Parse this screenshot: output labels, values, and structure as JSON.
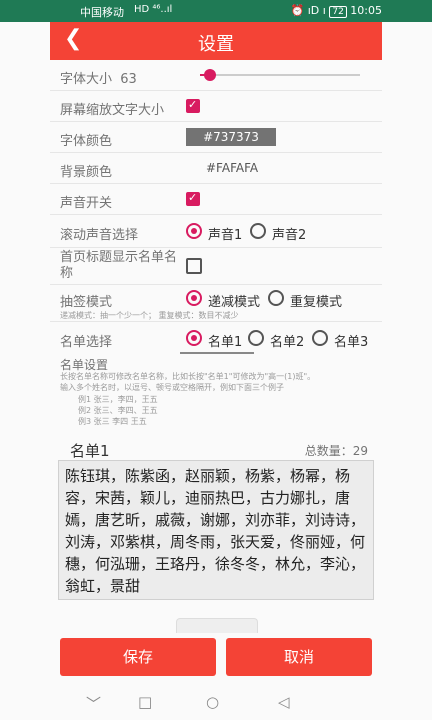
{
  "statusbar": {
    "carrier": "中国移动",
    "signal": "HD ⁴⁶..ıl",
    "icons": "⏰ ıD ı",
    "battery": "72",
    "time": "10:05"
  },
  "title": "设置",
  "font_size": {
    "label": "字体大小",
    "value": "63",
    "slider_fraction": 0.06
  },
  "zoom_text": {
    "label": "屏幕缩放文字大小",
    "checked": true
  },
  "font_color": {
    "label": "字体颜色",
    "value": "#737373",
    "swatch": "#737373"
  },
  "bg_color": {
    "label": "背景颜色",
    "value": "#FAFAFA"
  },
  "sound": {
    "label": "声音开关",
    "checked": true
  },
  "scroll_sound": {
    "label": "滚动声音选择",
    "options": [
      "声音1",
      "声音2"
    ],
    "selected": 0
  },
  "home_title": {
    "label": "首页标题显示名单名称",
    "checked": false
  },
  "draw_mode": {
    "label": "抽签模式",
    "options": [
      "递减模式",
      "重复模式"
    ],
    "selected": 0,
    "hint": "递减模式：抽一个少一个；  重复模式：数目不减少"
  },
  "list_select": {
    "label": "名单选择",
    "options": [
      "名单1",
      "名单2",
      "名单3"
    ],
    "selected": 0
  },
  "list_setting": {
    "label": "名单设置",
    "hint1": "长按名单名称可修改名单名称，比如长按\"名单1\"可修改为\"高一(1)班\"。",
    "hint2": "输入多个姓名时，以逗号、顿号或空格隔开，例如下面三个例子",
    "ex1": "例1   张三，李四，王五",
    "ex2": "例2   张三、李四、王五",
    "ex3": "例3   张三  李四  王五"
  },
  "list_name": "名单1",
  "total": "总数量：29",
  "names_text": "陈钰琪，陈紫函，赵丽颖，杨紫，杨幂，杨容，宋茜，颖儿，迪丽热巴，古力娜扎，唐嫣，唐艺昕，戚薇，谢娜，刘亦菲，刘诗诗，刘涛，邓紫棋，周冬雨，张天爱，佟丽娅，何穗，何泓珊，王珞丹，徐冬冬，林允，李沁，翁虹，景甜",
  "buttons": {
    "save": "保存",
    "cancel": "取消"
  },
  "colors": {
    "accent": "#f44336",
    "check": "#d81b60",
    "statusbar": "#1f7a55"
  }
}
